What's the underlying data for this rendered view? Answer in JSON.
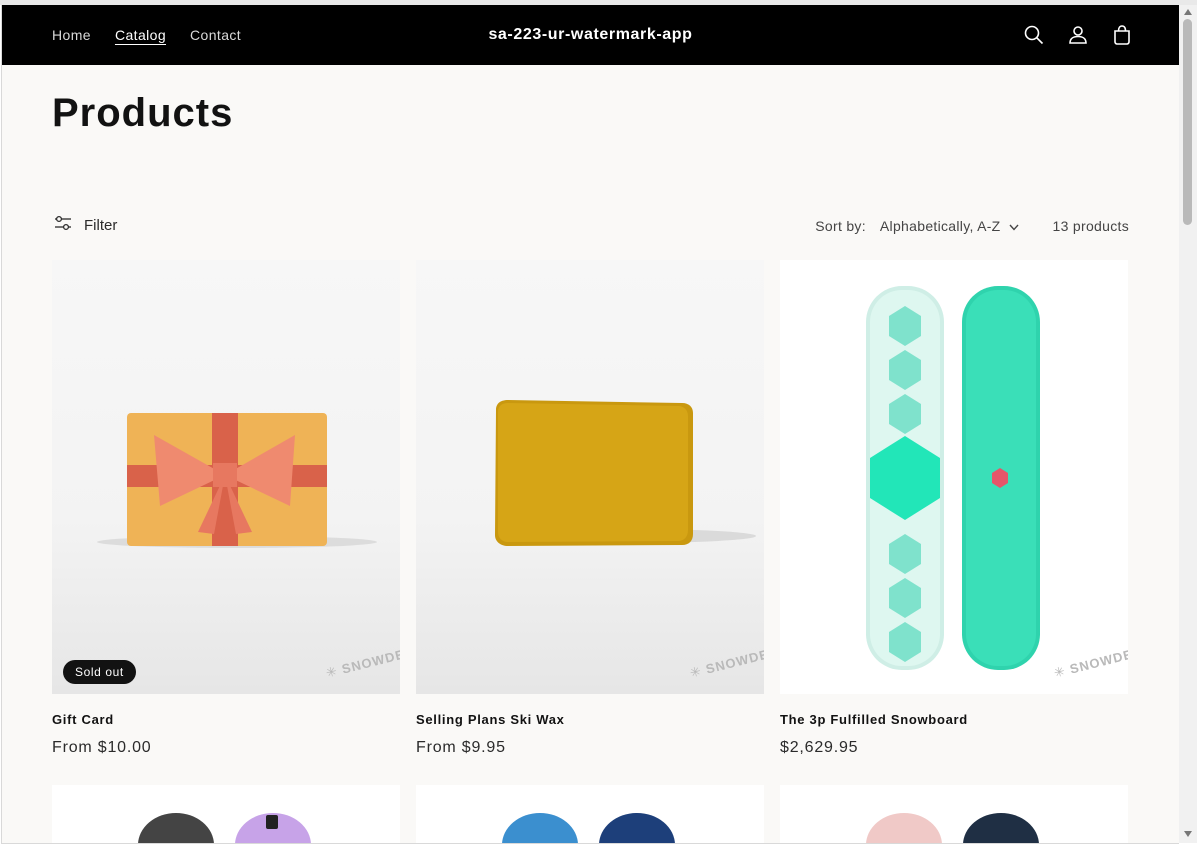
{
  "header": {
    "nav": [
      {
        "label": "Home"
      },
      {
        "label": "Catalog",
        "active": true
      },
      {
        "label": "Contact"
      }
    ],
    "store_name": "sa-223-ur-watermark-app",
    "icons": [
      "search-icon",
      "account-icon",
      "cart-icon"
    ]
  },
  "page": {
    "title": "Products"
  },
  "toolbar": {
    "filter_label": "Filter",
    "sort_label": "Sort by:",
    "sort_value": "Alphabetically, A-Z",
    "product_count": "13 products"
  },
  "products": [
    {
      "name": "Gift Card",
      "price": "From $10.00",
      "badge": "Sold out",
      "image": "gift-card-image",
      "watermark": "SNOWDE"
    },
    {
      "name": "Selling Plans Ski Wax",
      "price": "From $9.95",
      "image": "ski-wax-image",
      "watermark": "SNOWDE"
    },
    {
      "name": "The 3p Fulfilled Snowboard",
      "price": "$2,629.95",
      "image": "snowboard-image",
      "watermark": "SNOWDE"
    }
  ],
  "colors": {
    "header_bg": "#000000",
    "page_bg": "#faf9f7",
    "badge_bg": "#121212"
  }
}
